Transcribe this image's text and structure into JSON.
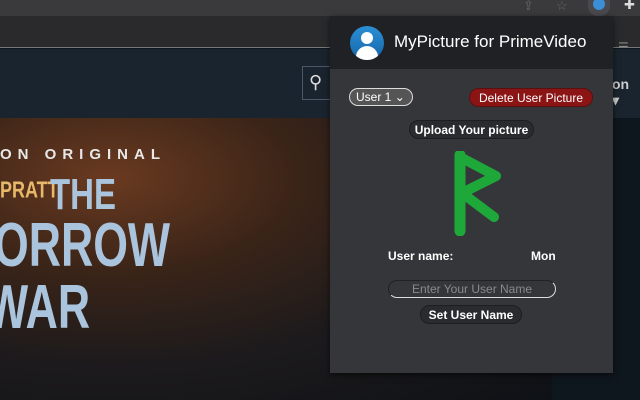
{
  "browser": {
    "share_icon": "share-icon",
    "star_icon": "star-icon",
    "profile_icon": "extension-profile-icon",
    "puzzle_icon": "puzzle-icon",
    "reader_icon": "reader-mode-icon"
  },
  "site": {
    "search_icon": "search-icon",
    "nav_partial": "on ▾",
    "hero": {
      "tagline": "ON ORIGINAL",
      "actor": "PRATT",
      "title_line1": "THE",
      "title_line2": "ORROW",
      "title_line3": "WAR"
    }
  },
  "popup": {
    "title": "MyPicture for PrimeVideo",
    "user_select": "User 1",
    "delete_label": "Delete User Picture",
    "upload_label": "Upload Your picture",
    "user_name_label": "User name:",
    "user_name_value": "Mon",
    "name_placeholder": "Enter Your User Name",
    "set_name_label": "Set User Name",
    "colors": {
      "delete": "#8b1515",
      "picture": "#1fa83a"
    }
  }
}
